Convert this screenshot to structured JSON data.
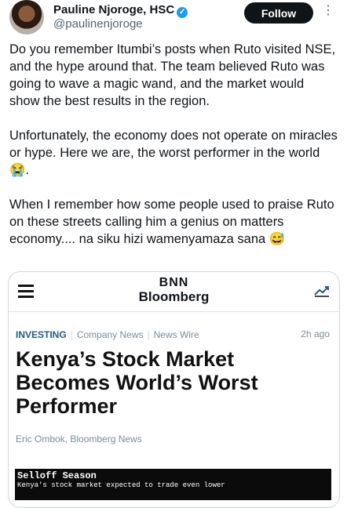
{
  "author": {
    "name": "Pauline Njoroge, HSC",
    "handle": "@paulinenjoroge",
    "follow_label": "Follow"
  },
  "tweet": {
    "paragraphs": [
      "Do you remember Itumbi’s posts when Ruto visited NSE, and the hype around that. The team believed Ruto was going to wave a magic wand, and the market would show the best results in the region.",
      "Unfortunately, the economy does not operate on miracles or hype. Here we are, the worst performer in the world 😭.",
      "When I remember how some people used to praise Ruto on these streets calling him a genius on matters economy.... na siku hizi wamenyamaza sana 😅"
    ]
  },
  "card": {
    "logo_top": "BNN",
    "logo_bottom": "Bloomberg",
    "categories": [
      "INVESTING",
      "Company News",
      "News Wire"
    ],
    "time": "2h ago",
    "headline": "Kenya’s Stock Market Becomes World’s Worst Performer",
    "byline": "Eric Ombok, Bloomberg News",
    "image_title": "Selloff Season",
    "image_subtitle": "Kenya's stock market expected to trade even lower"
  },
  "colors": {
    "verified": "#1d9bf0",
    "category_active": "#1f5c86",
    "follow_bg": "#0f1419"
  }
}
